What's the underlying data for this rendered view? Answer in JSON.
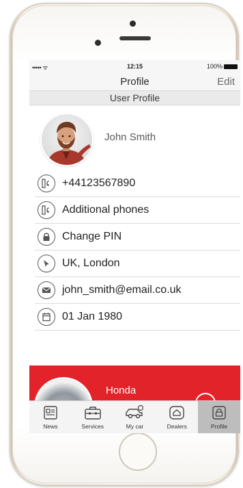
{
  "statusbar": {
    "signal": "••••• ᯤ",
    "time": "12:15",
    "battery": "100%"
  },
  "navbar": {
    "title": "Profile",
    "edit_label": "Edit"
  },
  "section": {
    "title": "User Profile"
  },
  "user": {
    "name": "John Smith"
  },
  "details": [
    {
      "label": "+44123567890",
      "icon": "phone-book-icon"
    },
    {
      "label": "Additional phones",
      "icon": "phone-book-icon"
    },
    {
      "label": "Change PIN",
      "icon": "lock-icon"
    },
    {
      "label": "UK, London",
      "icon": "location-arrow-icon"
    },
    {
      "label": "john_smith@email.co.uk",
      "icon": "mail-icon"
    },
    {
      "label": "01 Jan 1980",
      "icon": "calendar-icon"
    }
  ],
  "car": {
    "title": "Honda"
  },
  "tabs": [
    {
      "label": "News",
      "icon": "news-icon"
    },
    {
      "label": "Services",
      "icon": "toolbox-icon"
    },
    {
      "label": "My car",
      "icon": "car-icon"
    },
    {
      "label": "Dealers",
      "icon": "dealer-home-icon"
    },
    {
      "label": "Profile",
      "icon": "profile-lock-icon",
      "active": true
    }
  ],
  "colors": {
    "accent_red": "#e2232a",
    "active_tab": "#bdbdbd"
  }
}
